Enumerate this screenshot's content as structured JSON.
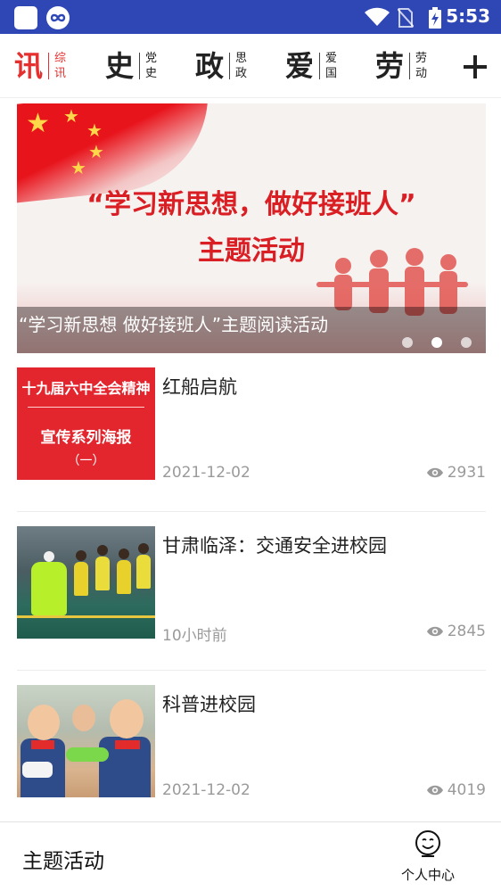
{
  "status_bar": {
    "time": "5:53"
  },
  "channels": [
    {
      "big": "讯",
      "small_top": "综",
      "small_bottom": "讯",
      "active": true
    },
    {
      "big": "史",
      "small_top": "党",
      "small_bottom": "史",
      "active": false
    },
    {
      "big": "政",
      "small_top": "思",
      "small_bottom": "政",
      "active": false
    },
    {
      "big": "爱",
      "small_top": "爱",
      "small_bottom": "国",
      "active": false
    },
    {
      "big": "劳",
      "small_top": "劳",
      "small_bottom": "动",
      "active": false
    }
  ],
  "banner": {
    "headline_line1": "“学习新思想，做好接班人”",
    "headline_line2": "主题活动",
    "caption": "“学习新思想 做好接班人”主题阅读活动",
    "slide_count": 3,
    "active_slide": 2
  },
  "news": [
    {
      "title": "红船启航",
      "date": "2021-12-02",
      "views": "2931",
      "thumb_text": {
        "line1": "十九届六中全会精神",
        "line2": "宣传系列海报",
        "line3": "（一）"
      }
    },
    {
      "title": "甘肃临泽：交通安全进校园",
      "date": "10小时前",
      "views": "2845"
    },
    {
      "title": "科普进校园",
      "date": "2021-12-02",
      "views": "4019"
    }
  ],
  "bottom_bar": {
    "title": "主题活动",
    "user_center_label": "个人中心"
  },
  "colors": {
    "status_bar": "#2f47b5",
    "accent_red": "#e63030",
    "meta_gray": "#9a9a9a"
  }
}
